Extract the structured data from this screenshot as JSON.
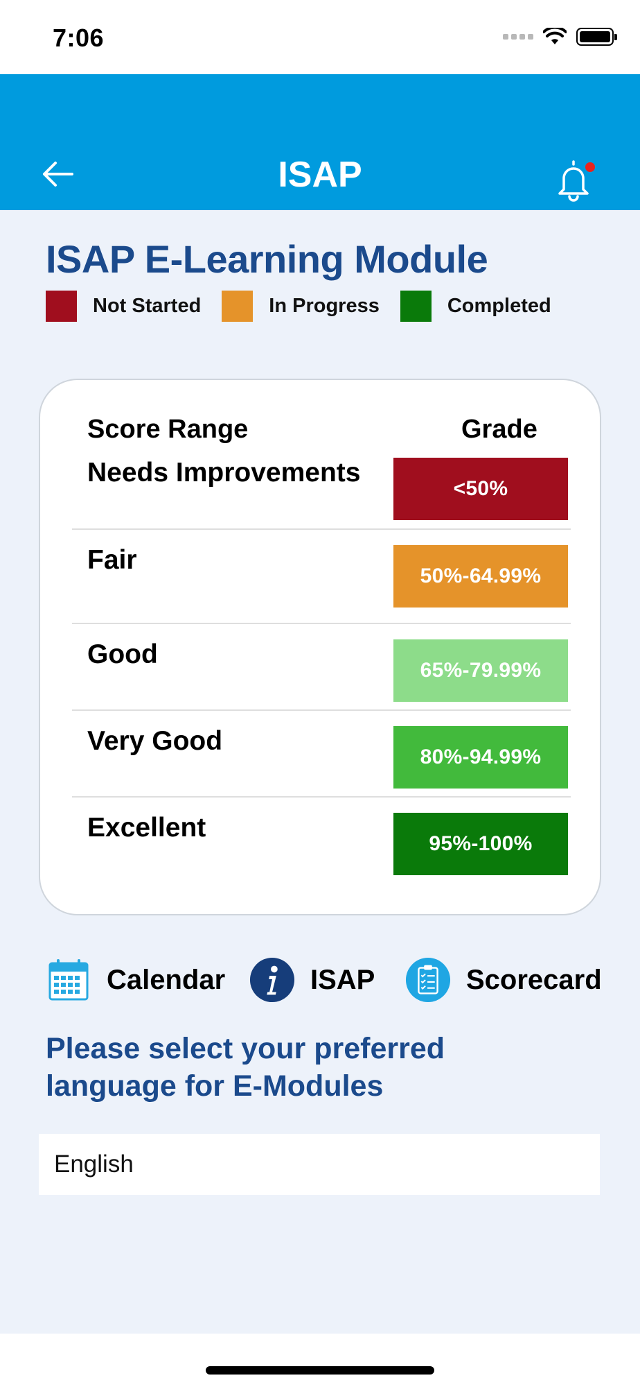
{
  "status_bar": {
    "time": "7:06"
  },
  "header": {
    "title": "ISAP"
  },
  "module": {
    "title": "ISAP E-Learning Module",
    "legend": [
      {
        "label": "Not Started",
        "color": "#a00e1e"
      },
      {
        "label": "In Progress",
        "color": "#e5932a"
      },
      {
        "label": "Completed",
        "color": "#0a7a0a"
      }
    ]
  },
  "grade_table": {
    "head_range": "Score Range",
    "head_grade": "Grade",
    "rows": [
      {
        "label": "Needs Improvements",
        "grade": "<50%",
        "color": "#a00e1e"
      },
      {
        "label": "Fair",
        "grade": "50%-64.99%",
        "color": "#e5932a"
      },
      {
        "label": "Good",
        "grade": "65%-79.99%",
        "color": "#8ddc8a"
      },
      {
        "label": "Very Good",
        "grade": "80%-94.99%",
        "color": "#42ba3c"
      },
      {
        "label": "Excellent",
        "grade": "95%-100%",
        "color": "#0a7a0a"
      }
    ]
  },
  "shortcuts": {
    "calendar": "Calendar",
    "isap": "ISAP",
    "scorecard": "Scorecard"
  },
  "language": {
    "prompt": "Please select your preferred language for E-Modules",
    "selected": "English"
  },
  "colors": {
    "header_bg": "#009bde",
    "title_blue": "#1b4a8c",
    "content_bg": "#edf2fa",
    "notification_dot": "#e8231e"
  }
}
